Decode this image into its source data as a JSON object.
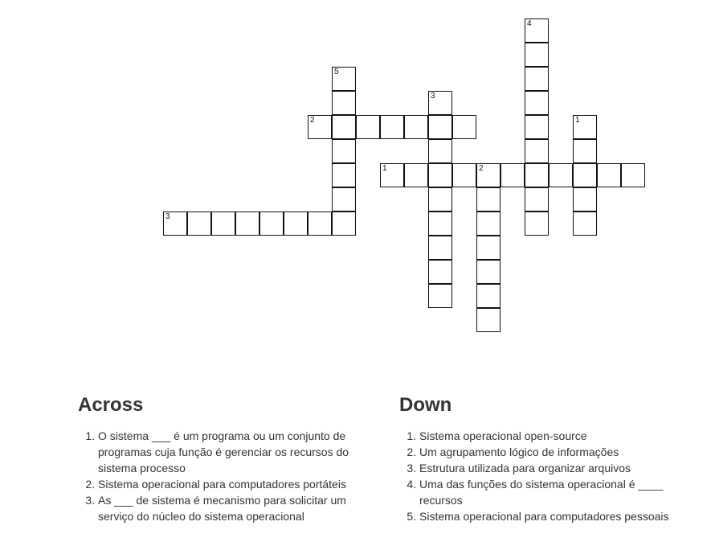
{
  "grid": {
    "cells": [
      {
        "c": 15,
        "r": 0
      },
      {
        "c": 15,
        "r": 1
      },
      {
        "c": 15,
        "r": 2
      },
      {
        "c": 15,
        "r": 3
      },
      {
        "c": 15,
        "r": 4
      },
      {
        "c": 15,
        "r": 5
      },
      {
        "c": 15,
        "r": 6
      },
      {
        "c": 15,
        "r": 7
      },
      {
        "c": 15,
        "r": 8
      },
      {
        "c": 7,
        "r": 2
      },
      {
        "c": 7,
        "r": 3
      },
      {
        "c": 7,
        "r": 4
      },
      {
        "c": 7,
        "r": 5
      },
      {
        "c": 7,
        "r": 6
      },
      {
        "c": 7,
        "r": 7
      },
      {
        "c": 7,
        "r": 8
      },
      {
        "c": 11,
        "r": 3
      },
      {
        "c": 11,
        "r": 4
      },
      {
        "c": 11,
        "r": 5
      },
      {
        "c": 11,
        "r": 6
      },
      {
        "c": 11,
        "r": 7
      },
      {
        "c": 11,
        "r": 8
      },
      {
        "c": 11,
        "r": 9
      },
      {
        "c": 11,
        "r": 10
      },
      {
        "c": 11,
        "r": 11
      },
      {
        "c": 6,
        "r": 4
      },
      {
        "c": 8,
        "r": 4
      },
      {
        "c": 9,
        "r": 4
      },
      {
        "c": 10,
        "r": 4
      },
      {
        "c": 12,
        "r": 4
      },
      {
        "c": 17,
        "r": 4
      },
      {
        "c": 17,
        "r": 5
      },
      {
        "c": 17,
        "r": 6
      },
      {
        "c": 17,
        "r": 7
      },
      {
        "c": 17,
        "r": 8
      },
      {
        "c": 9,
        "r": 6
      },
      {
        "c": 10,
        "r": 6
      },
      {
        "c": 12,
        "r": 6
      },
      {
        "c": 13,
        "r": 6
      },
      {
        "c": 14,
        "r": 6
      },
      {
        "c": 16,
        "r": 6
      },
      {
        "c": 18,
        "r": 6
      },
      {
        "c": 19,
        "r": 6
      },
      {
        "c": 13,
        "r": 7
      },
      {
        "c": 13,
        "r": 8
      },
      {
        "c": 13,
        "r": 9
      },
      {
        "c": 13,
        "r": 10
      },
      {
        "c": 13,
        "r": 11
      },
      {
        "c": 13,
        "r": 12
      },
      {
        "c": 0,
        "r": 8
      },
      {
        "c": 1,
        "r": 8
      },
      {
        "c": 2,
        "r": 8
      },
      {
        "c": 3,
        "r": 8
      },
      {
        "c": 4,
        "r": 8
      },
      {
        "c": 5,
        "r": 8
      },
      {
        "c": 6,
        "r": 8
      }
    ],
    "numbers": [
      {
        "c": 15,
        "r": 0,
        "n": "4"
      },
      {
        "c": 7,
        "r": 2,
        "n": "5"
      },
      {
        "c": 11,
        "r": 3,
        "n": "3"
      },
      {
        "c": 6,
        "r": 4,
        "n": "2"
      },
      {
        "c": 17,
        "r": 4,
        "n": "1"
      },
      {
        "c": 9,
        "r": 6,
        "n": "1"
      },
      {
        "c": 13,
        "r": 6,
        "n": "2"
      },
      {
        "c": 0,
        "r": 8,
        "n": "3"
      }
    ]
  },
  "across": {
    "heading": "Across",
    "clues": [
      "O sistema ___ é um programa ou um conjunto de programas cuja função é gerenciar os recursos do sistema processo",
      "Sistema operacional para computadores portáteis",
      "As ___ de sistema é mecanismo para solicitar um serviço do núcleo do sistema operacional"
    ]
  },
  "down": {
    "heading": "Down",
    "clues": [
      "Sistema operacional open-source",
      "Um agrupamento lógico de informações",
      "Estrutura utilizada para organizar arquivos",
      "Uma das funções do sistema operacional é ____ recursos",
      "Sistema operacional para computadores pessoais"
    ]
  }
}
